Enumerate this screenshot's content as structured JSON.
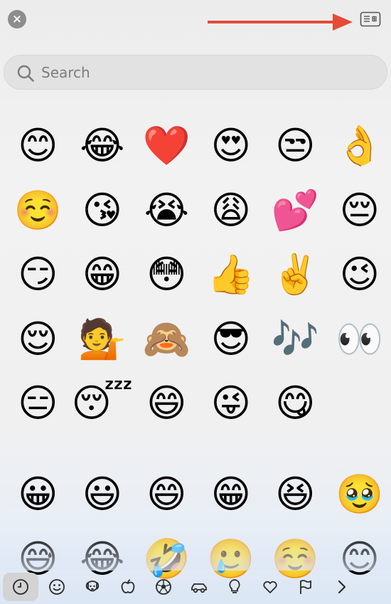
{
  "window": {
    "close_glyph": "×"
  },
  "search": {
    "placeholder": "Search"
  },
  "emoji_grid_top": [
    "😊",
    "😂",
    "❤️",
    "😍",
    "😒",
    "👌",
    "☺️",
    "😘",
    "😭",
    "😩",
    "💕",
    "😔",
    "😏",
    "😁",
    "😳",
    "👍",
    "✌️",
    "😉",
    "😌",
    "💁",
    "🙈",
    "😎",
    "🎶",
    "👀",
    "😑",
    "😴",
    "😄",
    "😜",
    "😋"
  ],
  "emoji_grid_bottom": [
    "😀",
    "😃",
    "😄",
    "😁",
    "😆",
    "🥹",
    "😅",
    "😂",
    "🤣",
    "🥲",
    "☺️",
    "😊"
  ],
  "tabs": [
    {
      "icon": "clock-icon",
      "active": true
    },
    {
      "icon": "smiley-icon",
      "active": false
    },
    {
      "icon": "dog-icon",
      "active": false
    },
    {
      "icon": "apple-icon",
      "active": false
    },
    {
      "icon": "soccer-ball-icon",
      "active": false
    },
    {
      "icon": "car-icon",
      "active": false
    },
    {
      "icon": "lightbulb-icon",
      "active": false
    },
    {
      "icon": "heart-icon",
      "active": false
    },
    {
      "icon": "flag-icon",
      "active": false
    },
    {
      "icon": "chevron-right-icon",
      "active": false
    }
  ],
  "colors": {
    "arrow": "#e54b37",
    "close_bg": "#8d8d8d",
    "icon_stroke": "#2a2a2a"
  }
}
